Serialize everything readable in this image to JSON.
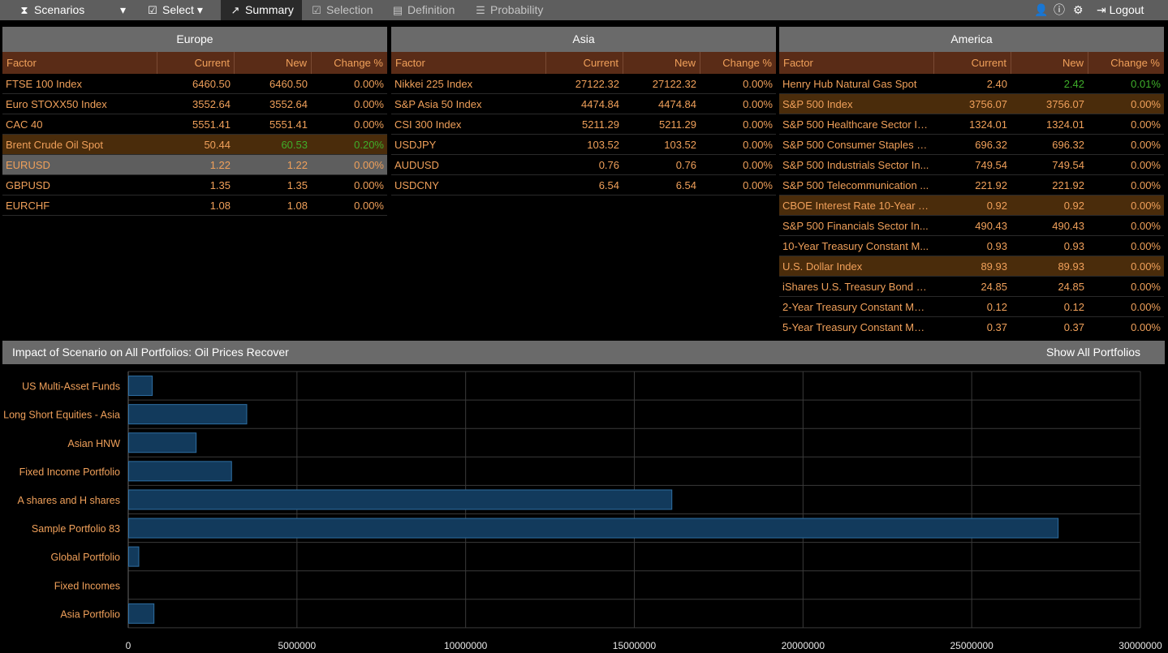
{
  "toolbar": {
    "app_label": "Scenarios",
    "select_label": "Select",
    "tabs": [
      {
        "label": "Summary",
        "icon": "share-icon",
        "active": true
      },
      {
        "label": "Selection",
        "icon": "check-square-icon",
        "active": false
      },
      {
        "label": "Definition",
        "icon": "list-alt-icon",
        "active": false
      },
      {
        "label": "Probability",
        "icon": "list-icon",
        "active": false
      }
    ],
    "logout_label": "Logout"
  },
  "columns": {
    "factor": "Factor",
    "current": "Current",
    "new": "New",
    "change": "Change %"
  },
  "panels": {
    "europe": {
      "title": "Europe",
      "rows": [
        {
          "factor": "FTSE 100 Index",
          "current": "6460.50",
          "new": "6460.50",
          "change": "0.00%",
          "state": ""
        },
        {
          "factor": "Euro STOXX50 Index",
          "current": "3552.64",
          "new": "3552.64",
          "change": "0.00%",
          "state": ""
        },
        {
          "factor": "CAC 40",
          "current": "5551.41",
          "new": "5551.41",
          "change": "0.00%",
          "state": ""
        },
        {
          "factor": "Brent Crude Oil Spot",
          "current": "50.44",
          "new": "60.53",
          "change": "0.20%",
          "state": "oil"
        },
        {
          "factor": "EURUSD",
          "current": "1.22",
          "new": "1.22",
          "change": "0.00%",
          "state": "sel"
        },
        {
          "factor": "GBPUSD",
          "current": "1.35",
          "new": "1.35",
          "change": "0.00%",
          "state": ""
        },
        {
          "factor": "EURCHF",
          "current": "1.08",
          "new": "1.08",
          "change": "0.00%",
          "state": ""
        }
      ]
    },
    "asia": {
      "title": "Asia",
      "rows": [
        {
          "factor": "Nikkei 225 Index",
          "current": "27122.32",
          "new": "27122.32",
          "change": "0.00%",
          "state": ""
        },
        {
          "factor": "S&P Asia 50 Index",
          "current": "4474.84",
          "new": "4474.84",
          "change": "0.00%",
          "state": ""
        },
        {
          "factor": "CSI 300 Index",
          "current": "5211.29",
          "new": "5211.29",
          "change": "0.00%",
          "state": ""
        },
        {
          "factor": "USDJPY",
          "current": "103.52",
          "new": "103.52",
          "change": "0.00%",
          "state": ""
        },
        {
          "factor": "AUDUSD",
          "current": "0.76",
          "new": "0.76",
          "change": "0.00%",
          "state": ""
        },
        {
          "factor": "USDCNY",
          "current": "6.54",
          "new": "6.54",
          "change": "0.00%",
          "state": ""
        }
      ]
    },
    "america": {
      "title": "America",
      "rows": [
        {
          "factor": "Henry Hub Natural Gas Spot",
          "current": "2.40",
          "new": "2.42",
          "change": "0.01%",
          "state": "changed"
        },
        {
          "factor": "S&P 500 Index",
          "current": "3756.07",
          "new": "3756.07",
          "change": "0.00%",
          "state": "oil"
        },
        {
          "factor": "S&P 500 Healthcare Sector In...",
          "current": "1324.01",
          "new": "1324.01",
          "change": "0.00%",
          "state": ""
        },
        {
          "factor": "S&P 500 Consumer Staples S...",
          "current": "696.32",
          "new": "696.32",
          "change": "0.00%",
          "state": ""
        },
        {
          "factor": "S&P 500 Industrials Sector In...",
          "current": "749.54",
          "new": "749.54",
          "change": "0.00%",
          "state": ""
        },
        {
          "factor": "S&P 500 Telecommunication ...",
          "current": "221.92",
          "new": "221.92",
          "change": "0.00%",
          "state": ""
        },
        {
          "factor": "CBOE Interest Rate 10-Year T-...",
          "current": "0.92",
          "new": "0.92",
          "change": "0.00%",
          "state": "oil"
        },
        {
          "factor": "S&P 500 Financials Sector In...",
          "current": "490.43",
          "new": "490.43",
          "change": "0.00%",
          "state": ""
        },
        {
          "factor": "10-Year Treasury Constant M...",
          "current": "0.93",
          "new": "0.93",
          "change": "0.00%",
          "state": ""
        },
        {
          "factor": "U.S. Dollar Index",
          "current": "89.93",
          "new": "89.93",
          "change": "0.00%",
          "state": "oil"
        },
        {
          "factor": "iShares U.S. Treasury Bond ETF",
          "current": "24.85",
          "new": "24.85",
          "change": "0.00%",
          "state": ""
        },
        {
          "factor": "2-Year Treasury Constant Mat...",
          "current": "0.12",
          "new": "0.12",
          "change": "0.00%",
          "state": ""
        },
        {
          "factor": "5-Year Treasury Constant Mat...",
          "current": "0.37",
          "new": "0.37",
          "change": "0.00%",
          "state": ""
        }
      ]
    }
  },
  "impact": {
    "title": "Impact of Scenario on All Portfolios: Oil Prices Recover",
    "show_all_label": "Show All Portfolios"
  },
  "colors": {
    "bar_fill": "#123a5c",
    "bar_stroke": "#2f6fa3",
    "label": "#f0a05a",
    "grid": "#3a3a3a"
  },
  "chart_data": {
    "type": "bar",
    "orientation": "horizontal",
    "categories": [
      "US Multi-Asset Funds",
      "Long Short Equities - Asia",
      "Asian HNW",
      "Fixed Income Portfolio",
      "A shares and H shares",
      "Sample Portfolio 83",
      "Global Portfolio",
      "Fixed Incomes",
      "Asia Portfolio"
    ],
    "values": [
      700000,
      3500000,
      2000000,
      3050000,
      16100000,
      27550000,
      300000,
      0,
      750000
    ],
    "xlim": [
      0,
      30000000
    ],
    "xticks": [
      "0",
      "5000000",
      "10000000",
      "15000000",
      "20000000",
      "25000000",
      "30000000"
    ],
    "grid": true
  }
}
